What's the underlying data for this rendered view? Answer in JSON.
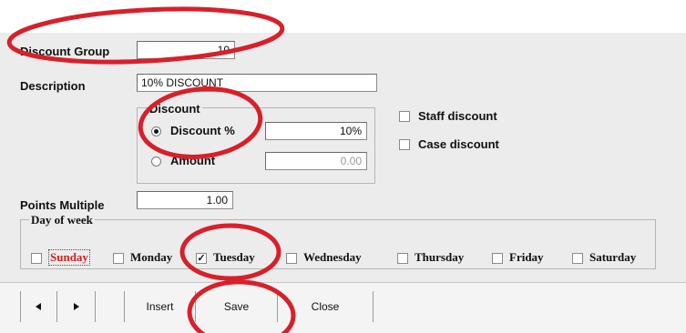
{
  "form": {
    "discount_group_label": "Discount Group",
    "discount_group_value": "10",
    "description_label": "Description",
    "description_value": "10% DISCOUNT",
    "points_multiple_label": "Points Multiple",
    "points_multiple_value": "1.00"
  },
  "discount_group": {
    "title": "Discount",
    "discount_option": "Discount %",
    "discount_value": "10%",
    "amount_option": "Amount",
    "amount_value": "0.00",
    "selected": "Discount %"
  },
  "flags": {
    "staff_discount": "Staff discount",
    "staff_discount_checked": false,
    "case_discount": "Case discount",
    "case_discount_checked": false
  },
  "days": {
    "title": "Day of week",
    "items": [
      {
        "label": "Sunday",
        "checked": false
      },
      {
        "label": "Monday",
        "checked": false
      },
      {
        "label": "Tuesday",
        "checked": true
      },
      {
        "label": "Wednesday",
        "checked": false
      },
      {
        "label": "Thursday",
        "checked": false
      },
      {
        "label": "Friday",
        "checked": false
      },
      {
        "label": "Saturday",
        "checked": false
      }
    ],
    "check_mark": "✓"
  },
  "toolbar": {
    "insert_label": "Insert",
    "save_label": "Save",
    "close_label": "Close"
  },
  "colors": {
    "annotation": "#d8202a",
    "sunday_text": "#d42020"
  }
}
